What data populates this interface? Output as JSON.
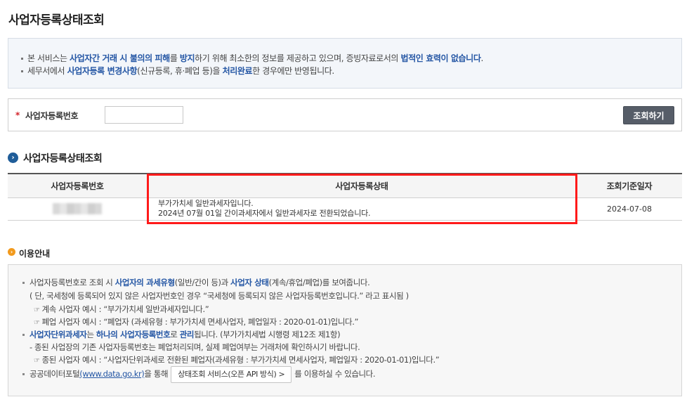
{
  "page": {
    "title": "사업자등록상태조회"
  },
  "notice": {
    "line1": [
      {
        "t": "본 서비스는 ",
        "h": false
      },
      {
        "t": "사업자간 거래 시 불의의 피해",
        "h": true
      },
      {
        "t": "를 ",
        "h": false
      },
      {
        "t": "방지",
        "h": true
      },
      {
        "t": "하기 위해 최소한의 정보를 제공하고 있으며, 증빙자료로서의 ",
        "h": false
      },
      {
        "t": "법적인 효력이 없습니다",
        "h": true
      },
      {
        "t": ".",
        "h": false
      }
    ],
    "line2": [
      {
        "t": "세무서에서 ",
        "h": false
      },
      {
        "t": "사업자등록 변경사항",
        "h": true
      },
      {
        "t": "(신규등록, 휴·폐업 등)을 ",
        "h": false
      },
      {
        "t": "처리완료",
        "h": true
      },
      {
        "t": "한 경우에만 반영됩니다.",
        "h": false
      }
    ]
  },
  "search": {
    "required_mark": "*",
    "label": "사업자등록번호",
    "value": "",
    "button_label": "조회하기"
  },
  "result": {
    "section_title": "사업자등록상태조회",
    "columns": [
      "사업자등록번호",
      "사업자등록상태",
      "조회기준일자"
    ],
    "rows": [
      {
        "status_line1": "부가가치세 일반과세자입니다.",
        "status_line2": "2024년 07월 01일 간이과세자에서 일반과세자로 전환되었습니다.",
        "date": "2024-07-08"
      }
    ]
  },
  "info": {
    "title": "이용안내",
    "lines": {
      "l1": [
        {
          "t": "사업자등록번호로 조회 시 ",
          "h": false
        },
        {
          "t": "사업자의 과세유형",
          "h": true
        },
        {
          "t": "(일반/간이 등)과 ",
          "h": false
        },
        {
          "t": "사업자 상태",
          "h": true
        },
        {
          "t": "(계속/휴업/폐업)를 보여줍니다.",
          "h": false
        }
      ],
      "l2": "( 단, 국세청에 등록되어 있지 않은 사업자번호인 경우 “국세청에 등록되지 않은 사업자등록번호입니다.” 라고 표시됨 )",
      "l3": "계속 사업자 예시 : “부가가치세 일반과세자입니다.”",
      "l4": "폐업 사업자 예시 : “폐업자 (과세유형 : 부가가치세 면세사업자, 폐업일자 : 2020-01-01)입니다.”",
      "l5": [
        {
          "t": "사업자단위과세자",
          "h": true
        },
        {
          "t": "는 ",
          "h": false
        },
        {
          "t": "하나의 사업자등록번호",
          "h": true
        },
        {
          "t": "로 ",
          "h": false
        },
        {
          "t": "관리",
          "h": true
        },
        {
          "t": "됩니다. (부가가치세법 시행령 제12조 제1항)",
          "h": false
        }
      ],
      "l6": "- 종된 사업장의 기존 사업자등록번호는 폐업처리되며, 실제 폐업여부는 거래처에 확인하시기 바랍니다.",
      "l7": "종된 사업자 예시 : “사업자단위과세로 전환된 폐업자(과세유형 : 부가가치세 면세사업자, 폐업일자 : 2020-01-01)입니다.”",
      "l8_prefix": "공공데이터포털",
      "l8_link": "(www.data.go.kr)",
      "l8_mid": "을 통해",
      "l8_button": "상태조회 서비스(오픈 API 방식) >",
      "l8_suffix": "를 이용하실 수 있습니다."
    }
  },
  "icons": {
    "section": "circle-arrow-right-icon",
    "info": "info-orange-dot-icon",
    "example": "pointing-hand-icon"
  },
  "colors": {
    "highlight_blue": "#2456a4",
    "required_red": "#d2232a",
    "annotation_red": "#ff1a1a",
    "button_gray": "#565d68"
  }
}
